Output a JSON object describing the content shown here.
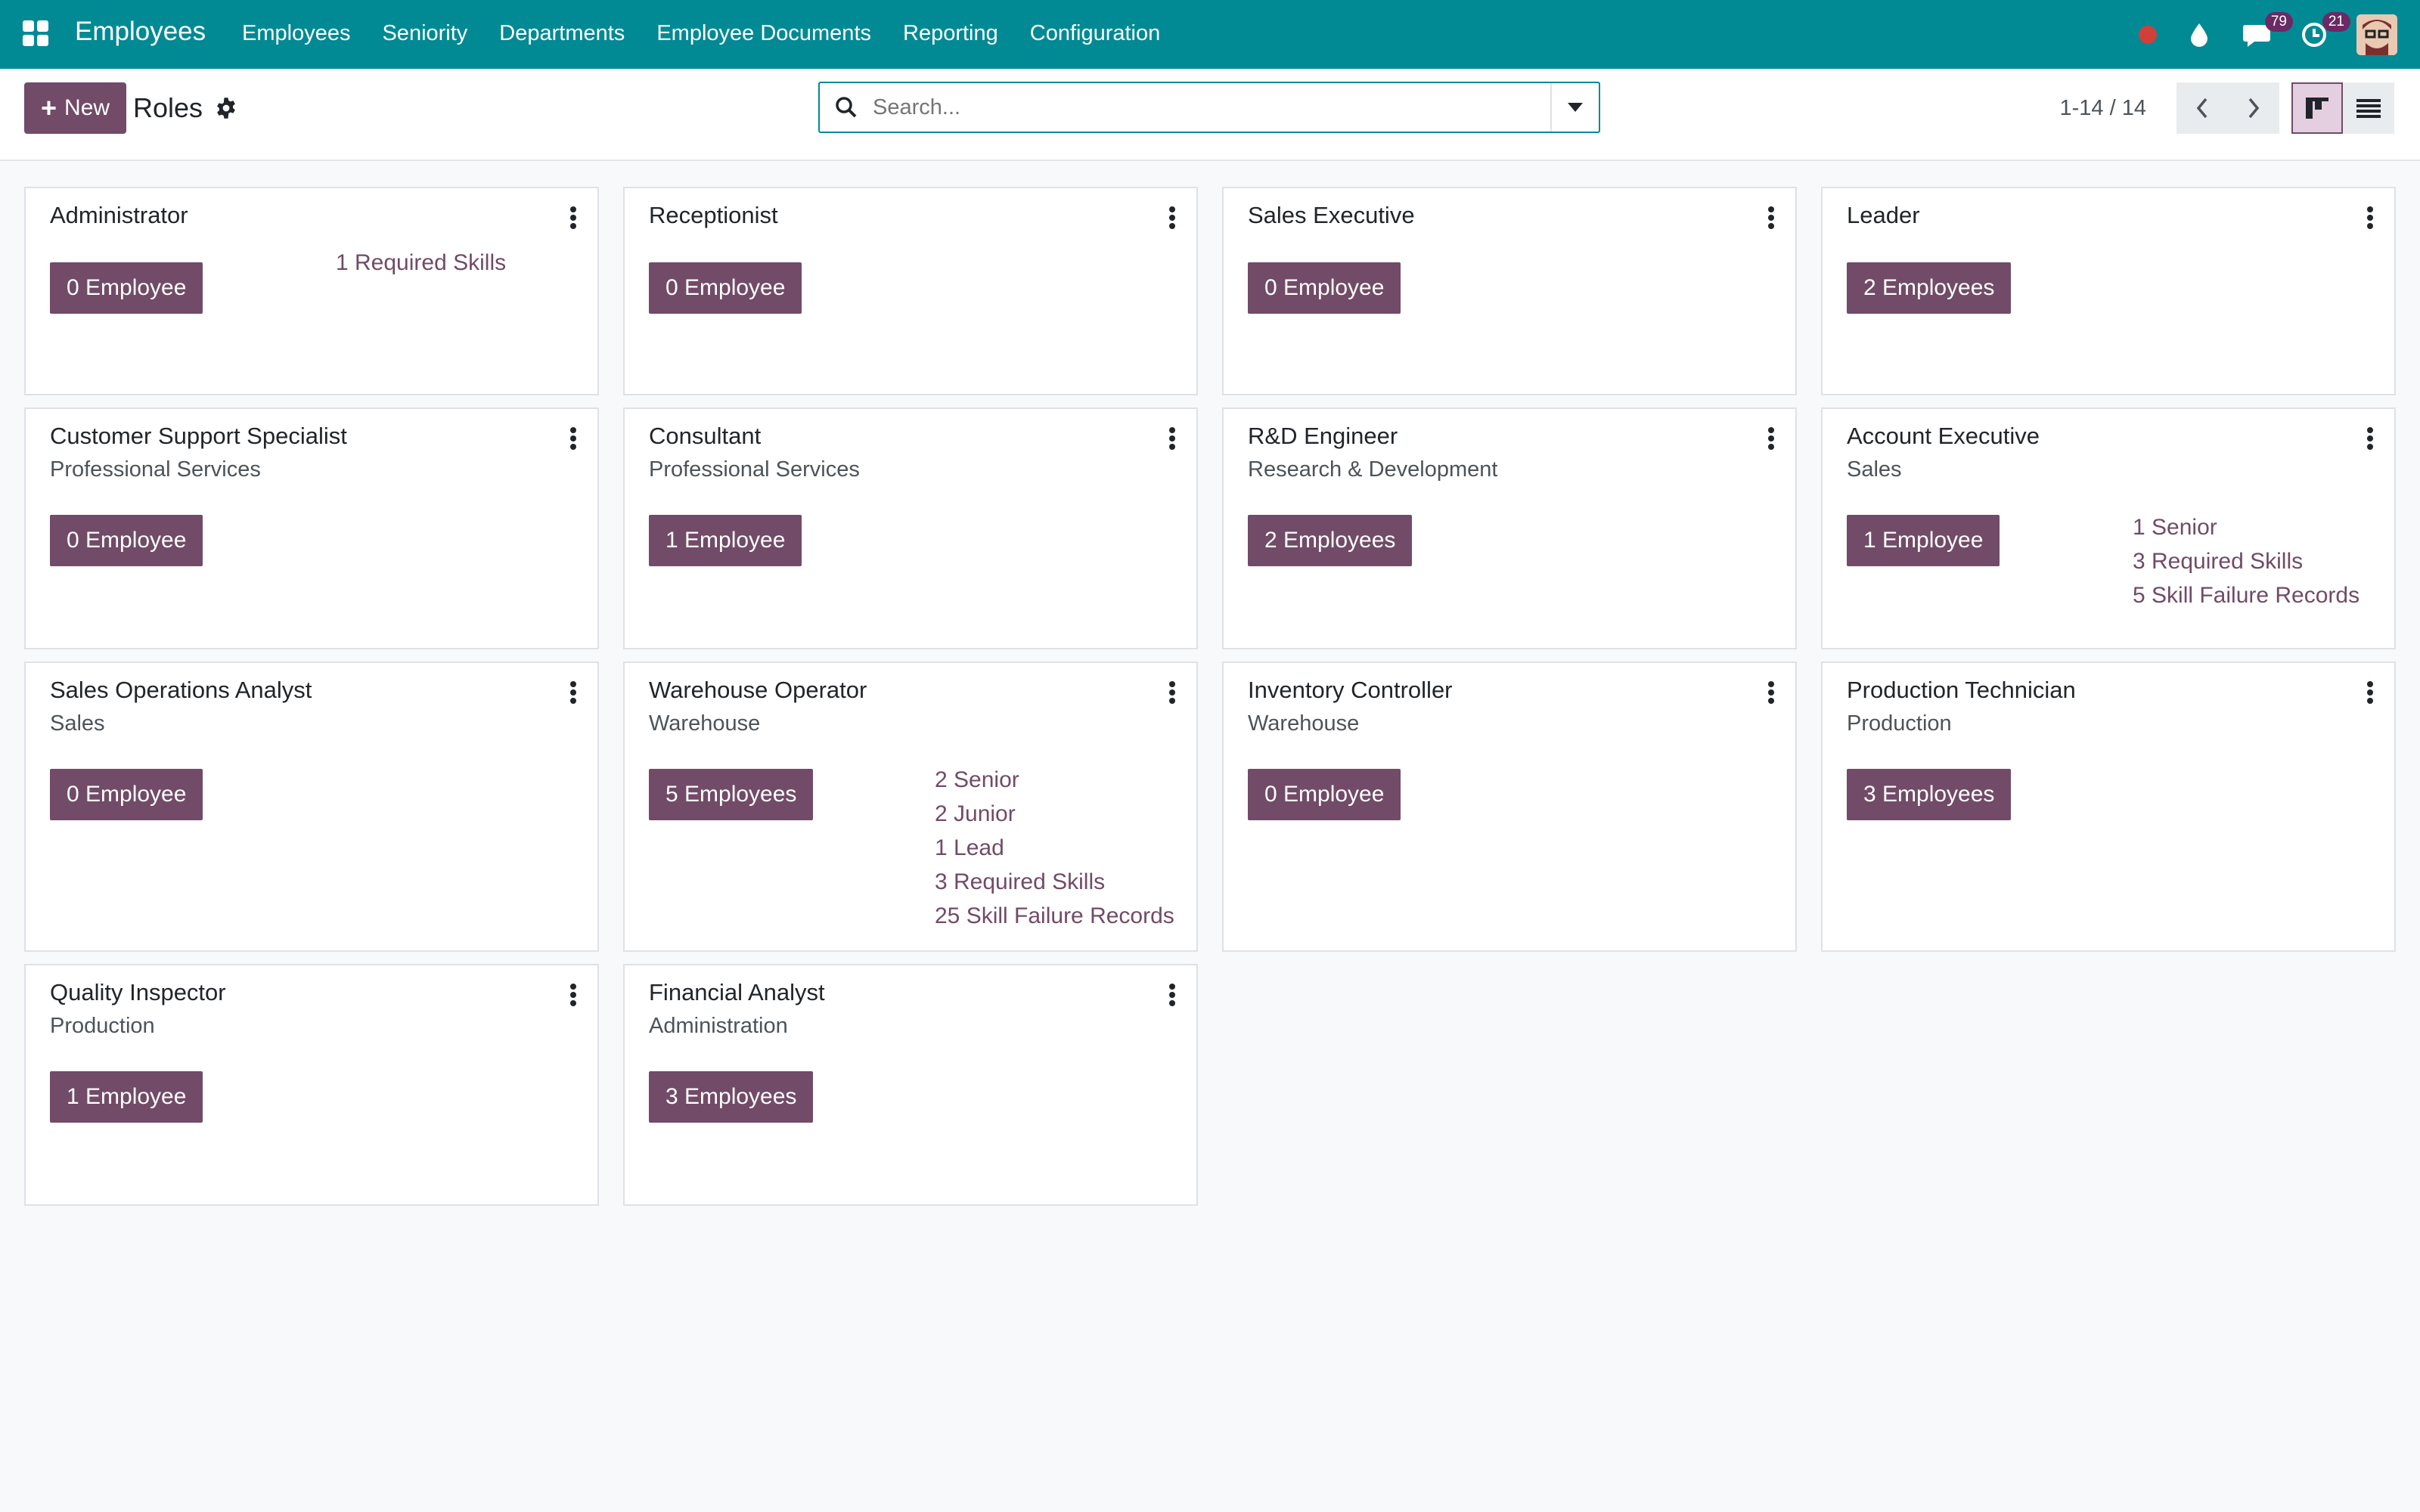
{
  "navbar": {
    "brand": "Employees",
    "menu": [
      "Employees",
      "Seniority",
      "Departments",
      "Employee Documents",
      "Reporting",
      "Configuration"
    ],
    "chat_count": "79",
    "activity_count": "21"
  },
  "control": {
    "new_label": "New",
    "title": "Roles",
    "search_placeholder": "Search...",
    "pager": "1-14 / 14"
  },
  "colors": {
    "navbar": "#018a94",
    "primary": "#714b67"
  },
  "cards": [
    {
      "name": "Administrator",
      "dept": "",
      "employees": "0 Employee",
      "links": [
        "1 Required Skills"
      ]
    },
    {
      "name": "Receptionist",
      "dept": "",
      "employees": "0 Employee",
      "links": []
    },
    {
      "name": "Sales Executive",
      "dept": "",
      "employees": "0 Employee",
      "links": []
    },
    {
      "name": "Leader",
      "dept": "",
      "employees": "2 Employees",
      "links": []
    },
    {
      "name": "Customer Support Specialist",
      "dept": "Professional Services",
      "employees": "0 Employee",
      "links": []
    },
    {
      "name": "Consultant",
      "dept": "Professional Services",
      "employees": "1 Employee",
      "links": []
    },
    {
      "name": "R&D Engineer",
      "dept": "Research & Development",
      "employees": "2 Employees",
      "links": []
    },
    {
      "name": "Account Executive",
      "dept": "Sales",
      "employees": "1 Employee",
      "links": [
        "1 Senior",
        "3 Required Skills",
        "5 Skill Failure Records"
      ]
    },
    {
      "name": "Sales Operations Analyst",
      "dept": "Sales",
      "employees": "0 Employee",
      "links": []
    },
    {
      "name": "Warehouse Operator",
      "dept": "Warehouse",
      "employees": "5 Employees",
      "links": [
        "2 Senior",
        "2 Junior",
        "1 Lead",
        "3 Required Skills",
        "25 Skill Failure Records"
      ]
    },
    {
      "name": "Inventory Controller",
      "dept": "Warehouse",
      "employees": "0 Employee",
      "links": []
    },
    {
      "name": "Production Technician",
      "dept": "Production",
      "employees": "3 Employees",
      "links": []
    },
    {
      "name": "Quality Inspector",
      "dept": "Production",
      "employees": "1 Employee",
      "links": []
    },
    {
      "name": "Financial Analyst",
      "dept": "Administration",
      "employees": "3 Employees",
      "links": []
    }
  ]
}
